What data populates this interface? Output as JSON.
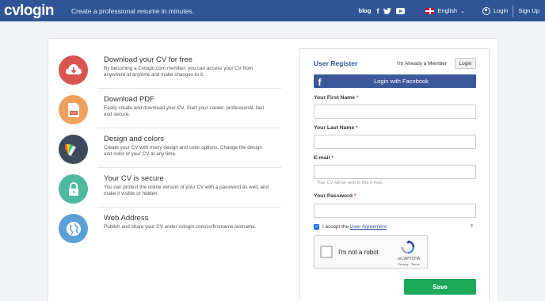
{
  "header": {
    "logo": "cvlogin",
    "tagline": "Create a professional resume in minutes.",
    "blog": "blog",
    "language": "English",
    "login": "Login",
    "signup": "Sign Up"
  },
  "features": [
    {
      "title": "Download your CV for free",
      "desc": "By becoming a Cvlogin.com member, you can access your CV from anywhere at anytime and make changes to it.",
      "color": "#d9534f",
      "icon": "download-cloud-icon"
    },
    {
      "title": "Download PDF",
      "desc": "Easily create and download your CV. Start your career, professional, fast and secure.",
      "color": "#f0a15e",
      "icon": "pdf-file-icon"
    },
    {
      "title": "Design and colors",
      "desc": "Create your CV with many design and color options. Change the design and color of your CV at any time.",
      "color": "#3d4a5c",
      "icon": "color-palette-icon"
    },
    {
      "title": "Your CV is secure",
      "desc": "You can protect the online version of your CV with a password as well, and make it visible or hidden.",
      "color": "#4fb9a0",
      "icon": "padlock-icon"
    },
    {
      "title": "Web Address",
      "desc": "Publish and share your CV under cvlogin.com/cv/firstname.lastname.",
      "color": "#5aa0d6",
      "icon": "globe-icon"
    }
  ],
  "register": {
    "title": "User Register",
    "already": "I'm Already a Member",
    "login_button": "Login",
    "facebook": "Login with Facebook",
    "first_name_label": "Your First Name",
    "last_name_label": "Your Last Name",
    "email_label": "E-mail",
    "email_hint": "Your CV will be sent to this e-mail.",
    "password_label": "Your Password",
    "required_mark": "*",
    "accept_prefix": "I accept the",
    "agreement_link": "User Agreement",
    "accept_suffix": ".",
    "captcha_text": "I'm not a robot",
    "captcha_brand": "reCAPTCHA",
    "captcha_terms": "Privacy - Terms",
    "save": "Save"
  },
  "colors": {
    "topbar": "#2f5597",
    "facebook": "#3b5998",
    "save": "#1ea85a"
  }
}
